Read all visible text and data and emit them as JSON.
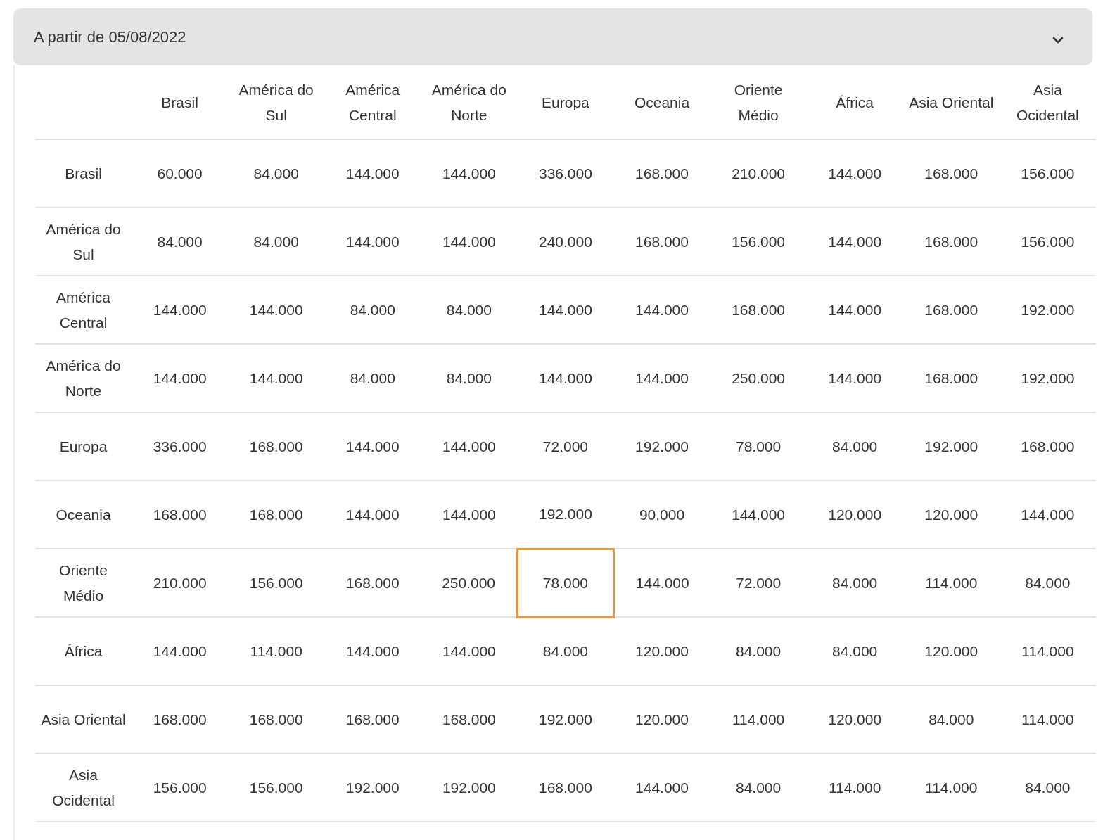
{
  "accordion": {
    "title": "A partir de 05/08/2022",
    "expanded": true
  },
  "table": {
    "columns": [
      "Brasil",
      "América do Sul",
      "América Central",
      "América do Norte",
      "Europa",
      "Oceania",
      "Oriente Médio",
      "África",
      "Asia Oriental",
      "Asia Ocidental"
    ],
    "rows": [
      {
        "label": "Brasil",
        "cells": [
          {
            "text": "60.000",
            "selected": false
          },
          {
            "text": "84.000",
            "selected": false
          },
          {
            "text": "144.000",
            "selected": false
          },
          {
            "text": "144.000",
            "selected": false
          },
          {
            "text": "336.000",
            "selected": false
          },
          {
            "text": "168.000",
            "selected": false
          },
          {
            "text": "210.000",
            "selected": false
          },
          {
            "text": "144.000",
            "selected": false
          },
          {
            "text": "168.000",
            "selected": false
          },
          {
            "text": "156.000",
            "selected": false
          }
        ]
      },
      {
        "label": "América do Sul",
        "cells": [
          {
            "text": "84.000",
            "selected": false
          },
          {
            "text": "84.000",
            "selected": false
          },
          {
            "text": "144.000",
            "selected": false
          },
          {
            "text": "144.000",
            "selected": false
          },
          {
            "text": "240.000",
            "selected": false
          },
          {
            "text": "168.000",
            "selected": false
          },
          {
            "text": "156.000",
            "selected": false
          },
          {
            "text": "144.000",
            "selected": false
          },
          {
            "text": "168.000",
            "selected": false
          },
          {
            "text": "156.000",
            "selected": false
          }
        ]
      },
      {
        "label": "América Central",
        "cells": [
          {
            "text": "144.000",
            "selected": false
          },
          {
            "text": "144.000",
            "selected": false
          },
          {
            "text": "84.000",
            "selected": false
          },
          {
            "text": "84.000",
            "selected": false
          },
          {
            "text": "144.000",
            "selected": false
          },
          {
            "text": "144.000",
            "selected": false
          },
          {
            "text": "168.000",
            "selected": false
          },
          {
            "text": "144.000",
            "selected": false
          },
          {
            "text": "168.000",
            "selected": false
          },
          {
            "text": "192.000",
            "selected": false
          }
        ]
      },
      {
        "label": "América do Norte",
        "cells": [
          {
            "text": "144.000",
            "selected": false
          },
          {
            "text": "144.000",
            "selected": false
          },
          {
            "text": "84.000",
            "selected": false
          },
          {
            "text": "84.000",
            "selected": false
          },
          {
            "text": "144.000",
            "selected": false
          },
          {
            "text": "144.000",
            "selected": false
          },
          {
            "text": "250.000",
            "selected": false
          },
          {
            "text": "144.000",
            "selected": false
          },
          {
            "text": "168.000",
            "selected": false
          },
          {
            "text": "192.000",
            "selected": false
          }
        ]
      },
      {
        "label": "Europa",
        "cells": [
          {
            "text": "336.000",
            "selected": false
          },
          {
            "text": "168.000",
            "selected": false
          },
          {
            "text": "144.000",
            "selected": false
          },
          {
            "text": "144.000",
            "selected": false
          },
          {
            "text": "72.000",
            "selected": false
          },
          {
            "text": "192.000",
            "selected": false
          },
          {
            "text": "78.000",
            "selected": false
          },
          {
            "text": "84.000",
            "selected": false
          },
          {
            "text": "192.000",
            "selected": false
          },
          {
            "text": "168.000",
            "selected": false
          }
        ]
      },
      {
        "label": "Oceania",
        "cells": [
          {
            "text": "168.000",
            "selected": false
          },
          {
            "text": "168.000",
            "selected": false
          },
          {
            "text": "144.000",
            "selected": false
          },
          {
            "text": "144.000",
            "selected": false
          },
          {
            "text": "192.000",
            "selected": false
          },
          {
            "text": "90.000",
            "selected": false
          },
          {
            "text": "144.000",
            "selected": false
          },
          {
            "text": "120.000",
            "selected": false
          },
          {
            "text": "120.000",
            "selected": false
          },
          {
            "text": "144.000",
            "selected": false
          }
        ]
      },
      {
        "label": "Oriente Médio",
        "cells": [
          {
            "text": "210.000",
            "selected": false
          },
          {
            "text": "156.000",
            "selected": false
          },
          {
            "text": "168.000",
            "selected": false
          },
          {
            "text": "250.000",
            "selected": false
          },
          {
            "text": "78.000",
            "selected": true
          },
          {
            "text": "144.000",
            "selected": false
          },
          {
            "text": "72.000",
            "selected": false
          },
          {
            "text": "84.000",
            "selected": false
          },
          {
            "text": "114.000",
            "selected": false
          },
          {
            "text": "84.000",
            "selected": false
          }
        ]
      },
      {
        "label": "África",
        "cells": [
          {
            "text": "144.000",
            "selected": false
          },
          {
            "text": "114.000",
            "selected": false
          },
          {
            "text": "144.000",
            "selected": false
          },
          {
            "text": "144.000",
            "selected": false
          },
          {
            "text": "84.000",
            "selected": false
          },
          {
            "text": "120.000",
            "selected": false
          },
          {
            "text": "84.000",
            "selected": false
          },
          {
            "text": "84.000",
            "selected": false
          },
          {
            "text": "120.000",
            "selected": false
          },
          {
            "text": "114.000",
            "selected": false
          }
        ]
      },
      {
        "label": "Asia Oriental",
        "cells": [
          {
            "text": "168.000",
            "selected": false
          },
          {
            "text": "168.000",
            "selected": false
          },
          {
            "text": "168.000",
            "selected": false
          },
          {
            "text": "168.000",
            "selected": false
          },
          {
            "text": "192.000",
            "selected": false
          },
          {
            "text": "120.000",
            "selected": false
          },
          {
            "text": "114.000",
            "selected": false
          },
          {
            "text": "120.000",
            "selected": false
          },
          {
            "text": "84.000",
            "selected": false
          },
          {
            "text": "114.000",
            "selected": false
          }
        ]
      },
      {
        "label": "Asia Ocidental",
        "cells": [
          {
            "text": "156.000",
            "selected": false
          },
          {
            "text": "156.000",
            "selected": false
          },
          {
            "text": "192.000",
            "selected": false
          },
          {
            "text": "192.000",
            "selected": false
          },
          {
            "text": "168.000",
            "selected": false
          },
          {
            "text": "144.000",
            "selected": false
          },
          {
            "text": "84.000",
            "selected": false
          },
          {
            "text": "114.000",
            "selected": false
          },
          {
            "text": "114.000",
            "selected": false
          },
          {
            "text": "84.000",
            "selected": false
          }
        ]
      }
    ]
  }
}
